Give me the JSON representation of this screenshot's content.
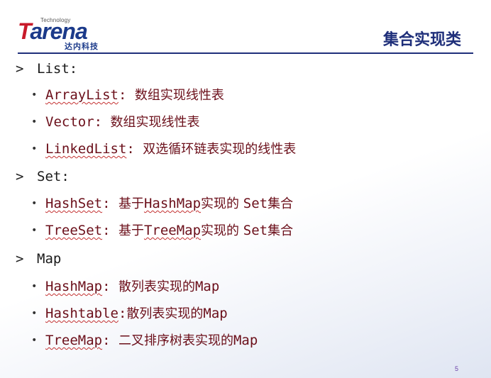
{
  "logo": {
    "small": "Technology",
    "big_t": "T",
    "big_rest": "arena",
    "cn": "达内科技"
  },
  "title": "集合实现类",
  "sections": {
    "list": {
      "head": "List:",
      "items": [
        {
          "name": "ArrayList",
          "sep": ": ",
          "desc": "数组实现线性表"
        },
        {
          "name": "Vector",
          "sep": ": ",
          "desc": "数组实现线性表"
        },
        {
          "name": "LinkedList",
          "sep": ": ",
          "desc": "双选循环链表实现的线性表"
        }
      ]
    },
    "set": {
      "head": "Set:",
      "items": [
        {
          "name": "HashSet",
          "sep": ": ",
          "d1": "基于",
          "ref": "HashMap",
          "d2": "实现的 ",
          "d3": "Set",
          "d4": "集合"
        },
        {
          "name": "TreeSet",
          "sep": ": ",
          "d1": "基于",
          "ref": "TreeMap",
          "d2": "实现的 ",
          "d3": "Set",
          "d4": "集合"
        }
      ]
    },
    "map": {
      "head": "Map",
      "items": [
        {
          "name": "HashMap",
          "sep": ": ",
          "desc": "散列表实现的",
          "tail": "Map"
        },
        {
          "name": "Hashtable",
          "sep": ":",
          "desc": "散列表实现的",
          "tail": "Map"
        },
        {
          "name": "TreeMap",
          "sep": ": ",
          "desc": "二叉排序树表实现的",
          "tail": "Map"
        }
      ]
    }
  },
  "page_number": "5",
  "glyphs": {
    "chevron": ">",
    "bullet": "•"
  },
  "colors": {
    "title": "#1f2f7a",
    "item_text": "#6b0f1a",
    "logo_red": "#c81a2a",
    "logo_blue": "#1b3a8a"
  }
}
